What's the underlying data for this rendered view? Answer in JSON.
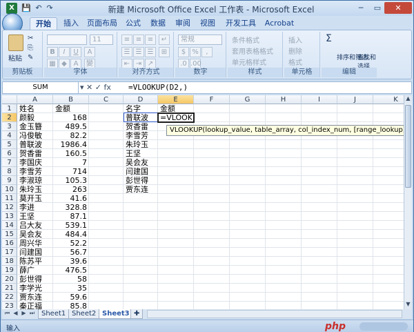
{
  "window": {
    "title": "新建 Microsoft Office Excel 工作表 - Microsoft Excel",
    "logo_label": "X",
    "minimize": "─",
    "maximize": "▭",
    "close": "✕"
  },
  "qat": {
    "save": "💾",
    "undo": "↶",
    "redo": "↷"
  },
  "ribbon": {
    "tabs": [
      "开始",
      "插入",
      "页面布局",
      "公式",
      "数据",
      "审阅",
      "视图",
      "开发工具",
      "Acrobat"
    ],
    "active_tab": "开始",
    "groups": {
      "clipboard": {
        "label": "剪贴板",
        "paste": "粘贴"
      },
      "font": {
        "label": "字体",
        "font_size": "11",
        "bold": "B",
        "italic": "I",
        "underline": "U",
        "grow": "A",
        "fill": "A",
        "wen": "變"
      },
      "alignment": {
        "label": "对齐方式"
      },
      "number": {
        "label": "数字",
        "format": "常规",
        "percent": "%",
        "comma": ",",
        "currency": "$"
      },
      "styles": {
        "label": "样式",
        "conditional": "条件格式",
        "table": "套用表格格式",
        "cell": "单元格样式"
      },
      "cells": {
        "label": "单元格",
        "insert": "插入",
        "delete": "删除",
        "format": "格式"
      },
      "editing": {
        "label": "编辑",
        "sum": "Σ",
        "sort": "排序和筛选",
        "find": "查找和选择"
      }
    }
  },
  "formula_bar": {
    "name_box": "SUM",
    "fx_buttons": "▾ ✕ ✓ fx",
    "formula": "=VLOOKUP(D2,)"
  },
  "grid": {
    "columns": [
      "A",
      "B",
      "C",
      "D",
      "E",
      "F",
      "G",
      "H",
      "I",
      "J",
      "K"
    ],
    "selected_column": "E",
    "selected_row": "2",
    "rows": [
      "1",
      "2",
      "3",
      "4",
      "5",
      "6",
      "7",
      "8",
      "9",
      "10",
      "11",
      "12",
      "13",
      "14",
      "15",
      "16",
      "17",
      "18",
      "19",
      "20",
      "21",
      "22",
      "23",
      "24"
    ],
    "colA": [
      "姓名",
      "颜毅",
      "金玉簪",
      "冯俊敏",
      "普联波",
      "贺香雷",
      "李国庆",
      "李雪芳",
      "李淑琼",
      "朱玲玉",
      "莫开玉",
      "李进",
      "王坚",
      "吕大友",
      "吴会友",
      "周兴华",
      "闫建国",
      "陈苏平",
      "薛广",
      "彭世得",
      "李学光",
      "贾东连",
      "秦正福"
    ],
    "colB": [
      "金额",
      "168",
      "489.5",
      "82.2",
      "1986.4",
      "160.5",
      "7",
      "714",
      "105.3",
      "263",
      "41.6",
      "328.8",
      "87.1",
      "539.1",
      "484.4",
      "52.2",
      "56.7",
      "39.6",
      "476.5",
      "58",
      "35",
      "59.6",
      "85.8"
    ],
    "colD": [
      "名字",
      "普联波",
      "贺香雷",
      "李雪芳",
      "朱玲玉",
      "王坚",
      "吴会友",
      "闫建国",
      "彭世得",
      "贾东连"
    ],
    "colE": [
      "金额",
      "=VLOOKUP(D2,)"
    ]
  },
  "tooltip": "VLOOKUP(lookup_value, table_array, col_index_num, [range_lookup])",
  "sheets": [
    "Sheet1",
    "Sheet2",
    "Sheet3"
  ],
  "active_sheet": "Sheet3",
  "status": {
    "mode": "输入",
    "watermark": "php"
  }
}
